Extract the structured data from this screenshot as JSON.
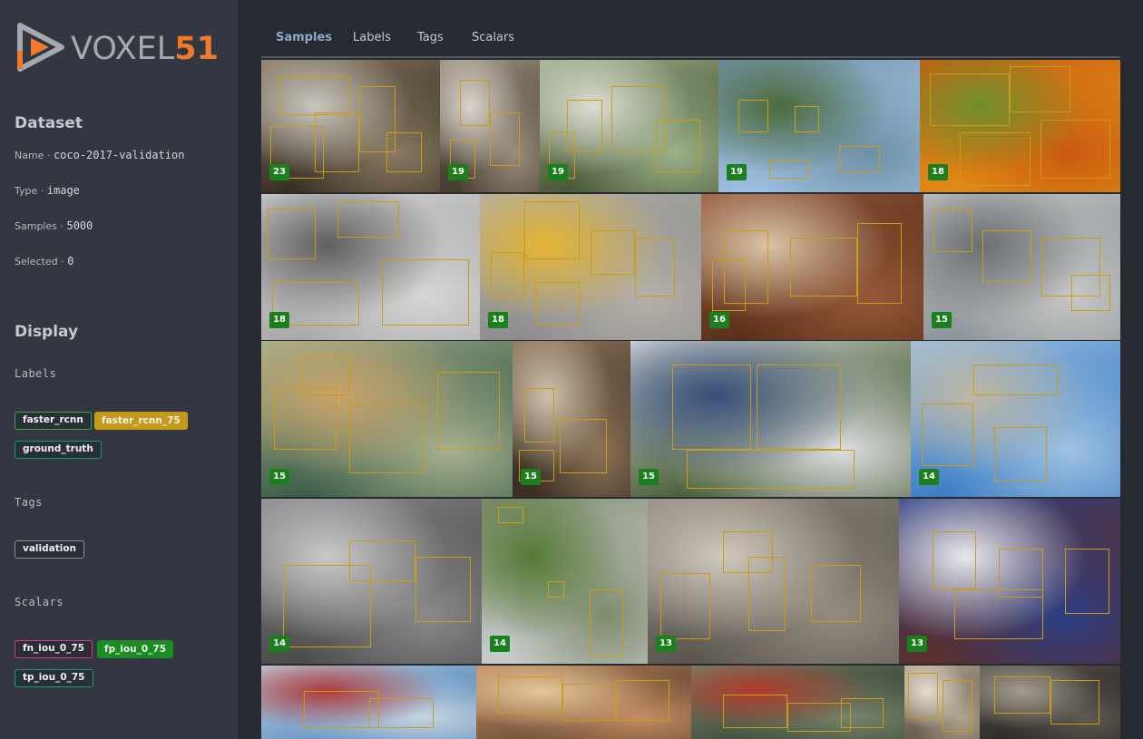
{
  "brand": {
    "name_light": "VOXEL",
    "name_bold": "51",
    "accent": "#ef7a2c"
  },
  "dataset": {
    "title": "Dataset",
    "name_label": "Name ·",
    "name": "coco-2017-validation",
    "type_label": "Type ·",
    "type": "image",
    "samples_label": "Samples ·",
    "samples": "5000",
    "selected_label": "Selected ·",
    "selected": "0"
  },
  "display": {
    "title": "Display",
    "labels_title": "Labels",
    "labels": [
      {
        "text": "faster_rcnn",
        "color": "#3ea741",
        "style": "outline"
      },
      {
        "text": "faster_rcnn_75",
        "color": "#c39a19",
        "style": "filled"
      },
      {
        "text": "ground_truth",
        "color": "#139b7a",
        "style": "outline"
      }
    ],
    "tags_title": "Tags",
    "tags": [
      {
        "text": "validation",
        "color": "#8b8f96",
        "style": "outline"
      }
    ],
    "scalars_title": "Scalars",
    "scalars": [
      {
        "text": "fn_iou_0_75",
        "color": "#e0368f",
        "style": "outline"
      },
      {
        "text": "fp_iou_0_75",
        "color": "#1c8b22",
        "style": "filled"
      },
      {
        "text": "tp_iou_0_75",
        "color": "#139b7a",
        "style": "outline"
      }
    ]
  },
  "tabs": [
    {
      "label": "Samples",
      "active": true
    },
    {
      "label": "Labels",
      "active": false
    },
    {
      "label": "Tags",
      "active": false
    },
    {
      "label": "Scalars",
      "active": false
    }
  ],
  "samples": [
    {
      "count": "23",
      "palette": [
        "#3a3126",
        "#8a7a61",
        "#c8c6c0"
      ]
    },
    {
      "count": "19",
      "palette": [
        "#4a3f33",
        "#9a8e7e",
        "#d9d4cc"
      ]
    },
    {
      "count": "19",
      "palette": [
        "#4d5a38",
        "#9bb28a",
        "#dcdcd3"
      ]
    },
    {
      "count": "19",
      "palette": [
        "#9ec0e0",
        "#6f8fa4",
        "#4b6a3c"
      ]
    },
    {
      "count": "18",
      "palette": [
        "#e08b16",
        "#c95a10",
        "#6e8f2c"
      ]
    },
    {
      "count": "18",
      "palette": [
        "#a9a9a9",
        "#d6d6d6",
        "#5f5f5f"
      ]
    },
    {
      "count": "18",
      "palette": [
        "#8d8d8d",
        "#b5b1a9",
        "#e3b533"
      ]
    },
    {
      "count": "16",
      "palette": [
        "#5b3019",
        "#96593a",
        "#d9c4a6"
      ]
    },
    {
      "count": "15",
      "palette": [
        "#8e969c",
        "#c7c7c4",
        "#6a6f72"
      ]
    },
    {
      "count": "15",
      "palette": [
        "#3c5d49",
        "#a8b28e",
        "#c9a36a"
      ]
    },
    {
      "count": "15",
      "palette": [
        "#3a2f24",
        "#8d7357",
        "#cfc2ad"
      ]
    },
    {
      "count": "15",
      "palette": [
        "#475c34",
        "#dedee2",
        "#37507a"
      ]
    },
    {
      "count": "14",
      "palette": [
        "#3f7fc6",
        "#9fc2e0",
        "#bfb6a2"
      ]
    },
    {
      "count": "14",
      "palette": [
        "#4c4c4c",
        "#8a8a8a",
        "#c9c9c9"
      ]
    },
    {
      "count": "14",
      "palette": [
        "#c6cacb",
        "#7e8b6b",
        "#557a35"
      ]
    },
    {
      "count": "13",
      "palette": [
        "#5a564f",
        "#958c80",
        "#cfc8bd"
      ]
    },
    {
      "count": "13",
      "palette": [
        "#5a2f2d",
        "#2c3f86",
        "#e8e8ec"
      ]
    },
    {
      "count": "",
      "palette": [
        "#5d8fc0",
        "#c7d4e0",
        "#b03b3b"
      ]
    },
    {
      "count": "",
      "palette": [
        "#6a4b34",
        "#c48d63",
        "#e4c79a"
      ]
    },
    {
      "count": "",
      "palette": [
        "#3d4a3a",
        "#77846a",
        "#b33b2b"
      ]
    },
    {
      "count": "",
      "palette": [
        "#6d6154",
        "#b2a48e",
        "#e6ddd0"
      ]
    },
    {
      "count": "",
      "palette": [
        "#2c2a28",
        "#5f5a52",
        "#a49c8e"
      ]
    }
  ]
}
